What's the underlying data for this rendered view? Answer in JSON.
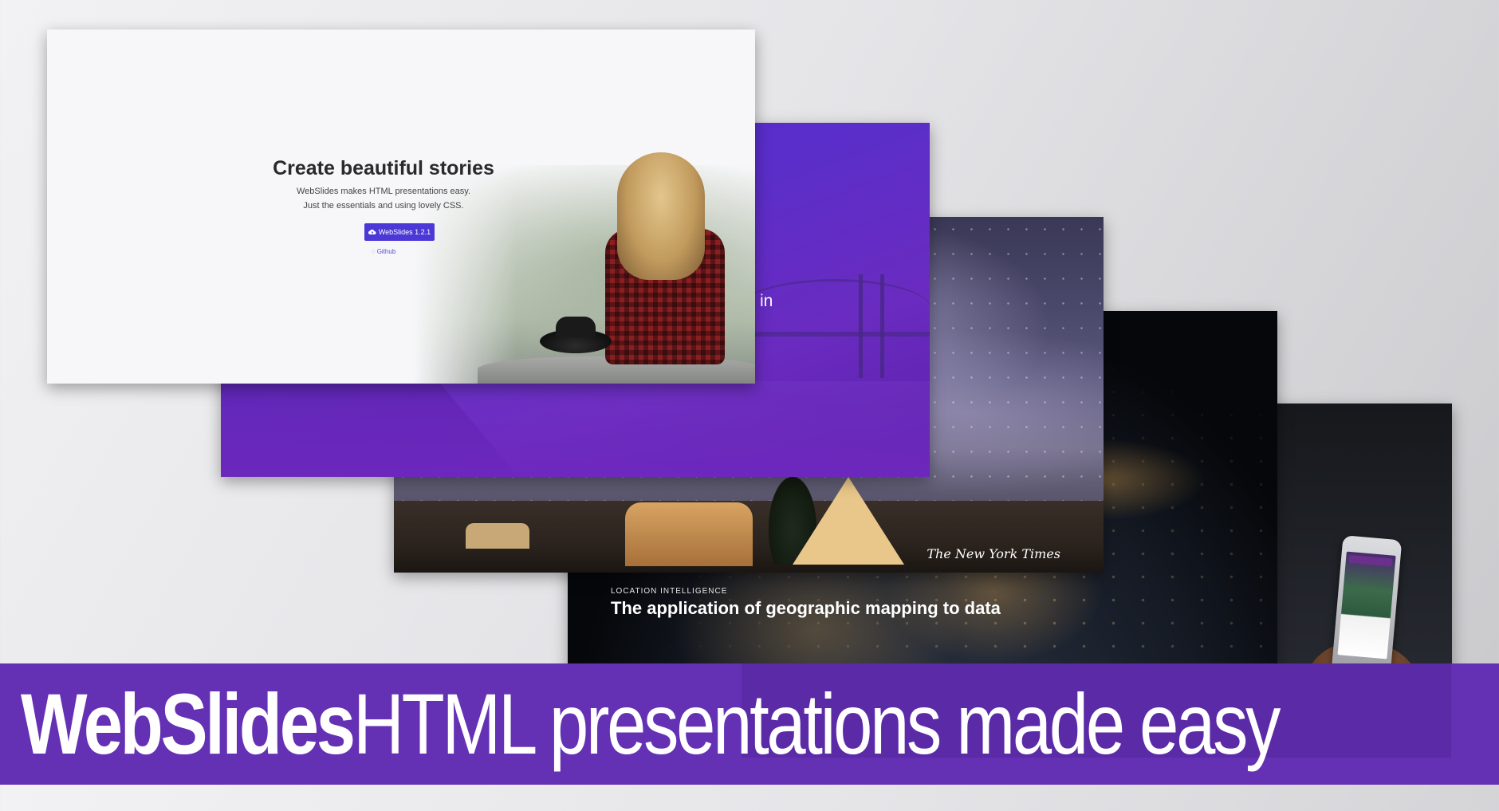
{
  "hero": {
    "title": "Create beautiful stories",
    "subtitle_line1": "WebSlides makes HTML presentations easy.",
    "subtitle_line2": "Just the essentials and using lovely CSS.",
    "button_label": "WebSlides 1.2.1",
    "button_icon": "cloud-download-icon",
    "github_label": "Github",
    "github_icon": "github-icon"
  },
  "purple_slide": {
    "text": "in"
  },
  "sky_slide": {
    "logo_text": "The New York Times"
  },
  "earth_slide": {
    "kicker": "LOCATION INTELLIGENCE",
    "title": "The application of geographic mapping to data"
  },
  "banner": {
    "brand": "WebSlides",
    "tagline": "HTML presentations made easy"
  },
  "colors": {
    "banner_bg": "#6531b4",
    "accent": "#4b38d6",
    "purple_slide": "#5b2ec9"
  }
}
